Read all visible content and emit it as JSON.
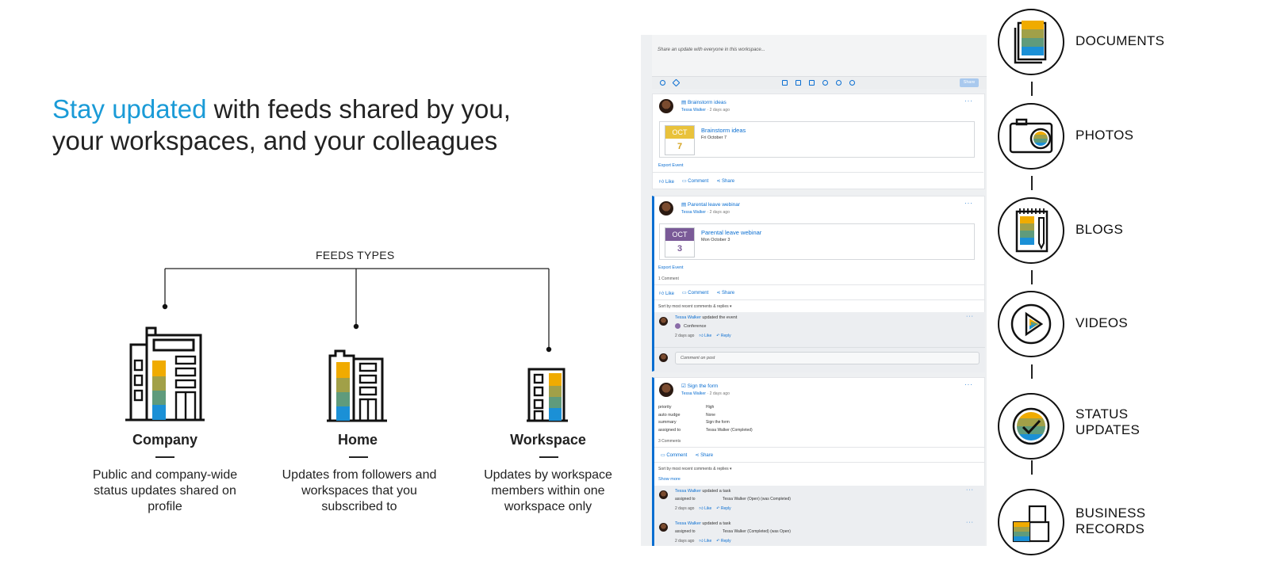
{
  "headline": {
    "accent": "Stay updated",
    "rest": " with feeds shared by you, your workspaces, and your colleagues"
  },
  "feeds_types_caption": "FEEDS TYPES",
  "feed_types": [
    {
      "title": "Company",
      "desc": "Public and company-wide status updates shared on profile"
    },
    {
      "title": "Home",
      "desc": "Updates from followers and workspaces that you subscribed to"
    },
    {
      "title": "Workspace",
      "desc": "Updates by workspace members within one workspace only"
    }
  ],
  "colors": {
    "accent": "#1a9bd7",
    "link": "#0a6ed1",
    "yellow": "#f0ab00",
    "olive": "#a1a048",
    "teal": "#5f9b7c",
    "blue": "#1b90d6",
    "cal_yellow": "#e9c23b",
    "cal_purple": "#7a5a97"
  },
  "feed": {
    "composer_placeholder": "Share an update with everyone in this workspace...",
    "share_label": "Share",
    "posts": [
      {
        "title": "Brainstorm ideas",
        "author": "Tessa Walker",
        "time": "2 days ago",
        "event_month": "OCT",
        "event_day": "7",
        "event_title": "Brainstorm ideas",
        "event_date": "Fri October 7",
        "export": "Export Event",
        "like": "Like",
        "comment": "Comment",
        "share": "Share"
      },
      {
        "title": "Parental leave webinar",
        "author": "Tessa Walker",
        "time": "2 days ago",
        "event_month": "OCT",
        "event_day": "3",
        "event_title": "Parental leave webinar",
        "event_date": "Mon October 3",
        "export": "Export Event",
        "comments_count": "1 Comment",
        "like": "Like",
        "comment": "Comment",
        "share": "Share",
        "sort": "Sort by most recent comments & replies ▾",
        "reply_author": "Tessa Walker",
        "reply_action": " updated the event",
        "reply_tag": "Conference",
        "reply_time": "2 days ago",
        "reply_like": "Like",
        "reply_reply": "Reply",
        "comment_placeholder": "Comment on post"
      },
      {
        "title": "Sign the form",
        "author": "Tessa Walker",
        "time": "2 days ago",
        "fields": [
          {
            "k": "priority",
            "v": "High"
          },
          {
            "k": "auto nudge",
            "v": "None"
          },
          {
            "k": "summary",
            "v": "Sign the form"
          },
          {
            "k": "assigned to",
            "v": "Tessa Walker (Completed)"
          }
        ],
        "comments_count": "3 Comments",
        "comment": "Comment",
        "share": "Share",
        "sort": "Sort by most recent comments & replies ▾",
        "show_more": "Show more",
        "replies": [
          {
            "author": "Tessa Walker",
            "action": " updated a task",
            "k": "assigned to",
            "v": "Tessa Walker (Open) (was Completed)",
            "time": "2 days ago",
            "like": "Like",
            "reply": "Reply"
          },
          {
            "author": "Tessa Walker",
            "action": " updated a task",
            "k": "assigned to",
            "v": "Tessa Walker (Completed) (was Open)",
            "time": "2 days ago",
            "like": "Like",
            "reply": "Reply"
          }
        ]
      }
    ]
  },
  "content_types": [
    {
      "label": "DOCUMENTS",
      "icon": "documents-icon"
    },
    {
      "label": "PHOTOS",
      "icon": "camera-icon"
    },
    {
      "label": "BLOGS",
      "icon": "blog-notebook-icon"
    },
    {
      "label": "VIDEOS",
      "icon": "play-icon"
    },
    {
      "label": "STATUS\nUPDATES",
      "icon": "status-check-icon"
    },
    {
      "label": "BUSINESS\nRECORDS",
      "icon": "business-records-icon"
    }
  ]
}
